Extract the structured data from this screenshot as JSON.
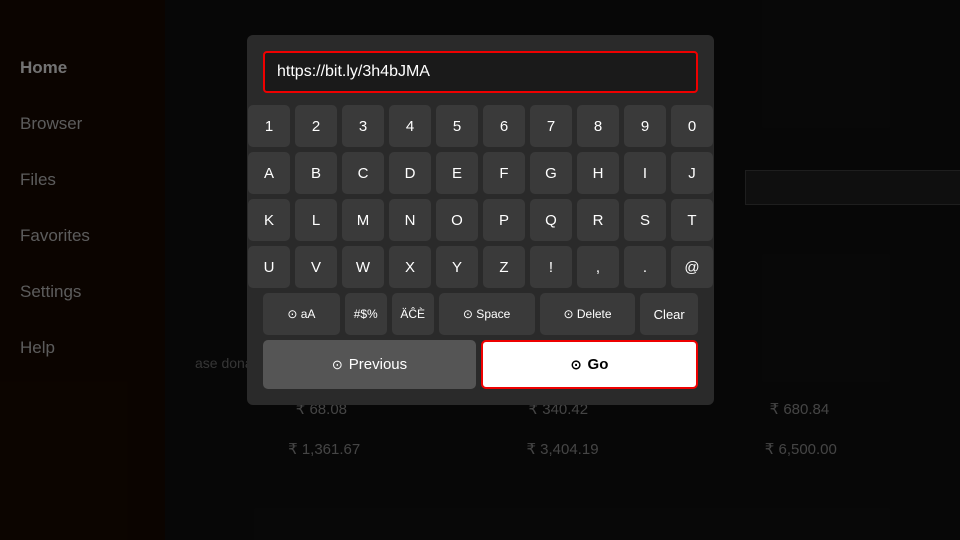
{
  "sidebar": {
    "items": [
      {
        "label": "Home",
        "active": true
      },
      {
        "label": "Browser",
        "active": false
      },
      {
        "label": "Files",
        "active": false
      },
      {
        "label": "Favorites",
        "active": false
      },
      {
        "label": "Settings",
        "active": false
      },
      {
        "label": "Help",
        "active": false
      }
    ]
  },
  "dialog": {
    "url_value": "https://bit.ly/3h4bJMA",
    "url_placeholder": "https://bit.ly/3h4bJMA",
    "keyboard": {
      "row1": [
        "1",
        "2",
        "3",
        "4",
        "5",
        "6",
        "7",
        "8",
        "9",
        "0"
      ],
      "row2": [
        "A",
        "B",
        "C",
        "D",
        "E",
        "F",
        "G",
        "H",
        "I",
        "J"
      ],
      "row3": [
        "K",
        "L",
        "M",
        "N",
        "O",
        "P",
        "Q",
        "R",
        "S",
        "T"
      ],
      "row4": [
        "U",
        "V",
        "W",
        "X",
        "Y",
        "Z",
        "!",
        ",",
        ".",
        "@"
      ],
      "row5_special": [
        "⊙ aA",
        "#$%",
        "ÄĈÈ",
        "⊙ Space",
        "⊙ Delete",
        "Clear"
      ]
    },
    "previous_label": "Previous",
    "go_label": "Go",
    "previous_icon": "⊙",
    "go_icon": "⊙"
  },
  "background": {
    "donation_text": "ase donation buttons:",
    "price_row1": [
      "₹ 68.08",
      "₹ 340.42",
      "₹ 680.84"
    ],
    "price_row2": [
      "₹ 1,361.67",
      "₹ 3,404.19",
      "₹ 6,500.00"
    ]
  }
}
